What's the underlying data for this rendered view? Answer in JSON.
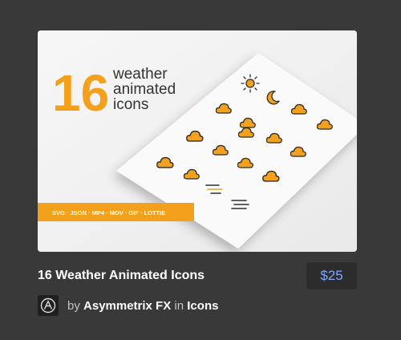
{
  "item": {
    "title": "16 Weather Animated Icons",
    "price": "$25",
    "by_label": "by",
    "author": "Asymmetrix FX",
    "in_label": "in",
    "category": "Icons"
  },
  "preview": {
    "big_number": "16",
    "headline_lines": [
      "weather",
      "animated",
      "icons"
    ],
    "formats": [
      "SVG",
      "JSON",
      "MP4",
      "MOV",
      "GIF",
      "LOTTIE"
    ],
    "accent_color": "#f3a11c",
    "icon_set": [
      "sun-icon",
      "moon-icon",
      "cloud-rain-icon",
      "cloud-sun-icon",
      "cloud-snow-icon",
      "cloud-sun-icon",
      "cloud-lightning-icon",
      "cloud-sun-icon",
      "cloud-rain-icon",
      "cloud-sun-icon",
      "cloud-sun-icon",
      "cloud-snow-icon",
      "cloud-sun-icon",
      "cloud-rain-icon",
      "wind-icon",
      "fog-icon"
    ]
  },
  "colors": {
    "background": "#393939",
    "price_text": "#7fa6ff"
  }
}
